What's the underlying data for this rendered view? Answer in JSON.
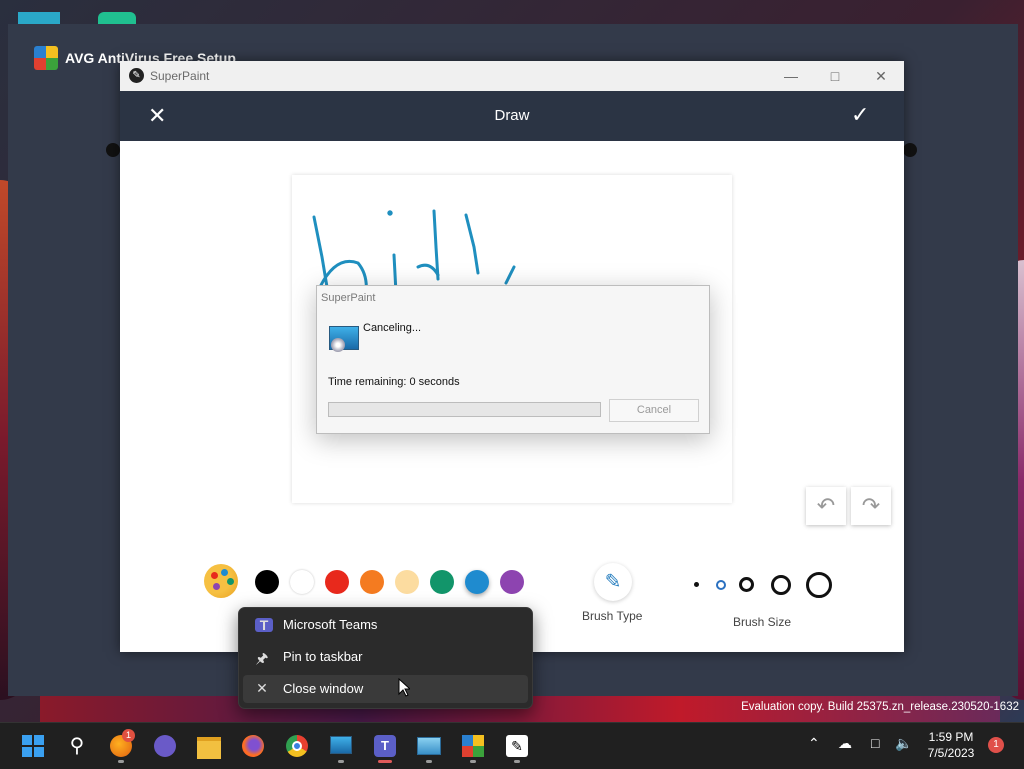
{
  "background_window": {
    "title": "AVG AntiVirus Free Setup"
  },
  "superpaint": {
    "title": "SuperPaint",
    "header": {
      "title": "Draw"
    },
    "canvas": {
      "stroke_color": "#1f8fbf"
    },
    "colors": [
      "#000000",
      "#ffffff",
      "#e8291c",
      "#f47b20",
      "#fcdca0",
      "#12956a",
      "#1f8bcf",
      "#8d44b0"
    ],
    "brush_type_label": "Brush Type",
    "brush_size_label": "Brush Size",
    "brush_sizes": [
      "xs",
      "s",
      "m",
      "l",
      "xl"
    ],
    "selected_brush_size": "s"
  },
  "progress_dialog": {
    "title": "SuperPaint",
    "message": "Canceling...",
    "time_remaining": "Time remaining: 0 seconds",
    "progress": 0,
    "cancel_label": "Cancel"
  },
  "context_menu": {
    "items": [
      {
        "label": "Microsoft Teams",
        "icon": "teams-icon"
      },
      {
        "label": "Pin to taskbar",
        "icon": "pin-icon"
      },
      {
        "label": "Close window",
        "icon": "close-icon"
      }
    ],
    "hovered_index": 2
  },
  "watermark": "Evaluation copy. Build 25375.zn_release.230520-1632",
  "taskbar": {
    "apps": [
      {
        "name": "start-icon"
      },
      {
        "name": "search-icon"
      },
      {
        "name": "firefox-nightly-icon",
        "badge": "1"
      },
      {
        "name": "video-chat-icon"
      },
      {
        "name": "file-explorer-icon"
      },
      {
        "name": "firefox-icon"
      },
      {
        "name": "chrome-icon"
      },
      {
        "name": "setup-icon"
      },
      {
        "name": "teams-icon",
        "active": true
      },
      {
        "name": "control-panel-icon"
      },
      {
        "name": "avg-installer-icon"
      },
      {
        "name": "superpaint-icon"
      }
    ],
    "time": "1:59 PM",
    "date": "7/5/2023",
    "notification_count": "1"
  }
}
